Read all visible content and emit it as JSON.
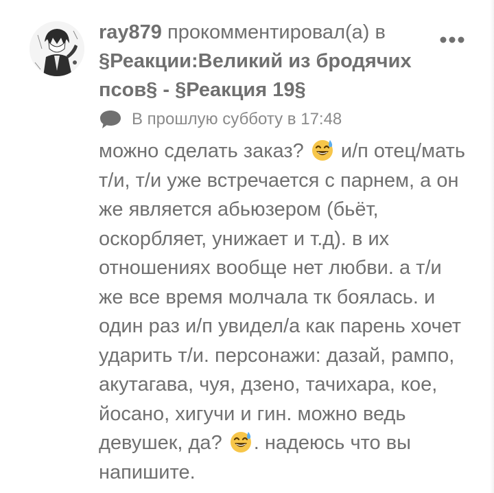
{
  "user": {
    "name": "ray879",
    "avatar_icon": "anime-character-avatar"
  },
  "header": {
    "action_text": " прокомментировал(а) в ",
    "target": "§Реакции:Великий из бродячих псов§ - §Реакция 19§"
  },
  "meta": {
    "icon": "speech-bubble-icon",
    "timestamp": "В прошлую субботу в 17:48"
  },
  "comment": {
    "part1": "можно сделать заказ? ",
    "emoji": "smiling-face-with-sweat",
    "part2": " и/п отец/мать т/и, т/и уже встречается с парнем, а он же является абьюзером (бьёт, оскорбляет, унижает и т.д). в их отношениях вообще нет любви. а т/и же все время молчала тк боялась. и один раз и/п увидел/а как парень хочет ударить т/и. персонажи: дазай, рампо, акутагава, чуя, дзено, тачихара, кое, йосано, хигучи и гин. можно ведь девушек, да? ",
    "part3": ". надеюсь что вы напишите."
  },
  "menu": {
    "icon": "more-options-icon"
  },
  "colors": {
    "text": "#707070",
    "meta_text": "#8a8a8a",
    "icon_gray": "#707070",
    "emoji_yellow": "#F7C64A",
    "emoji_sweat": "#5DADEC"
  }
}
